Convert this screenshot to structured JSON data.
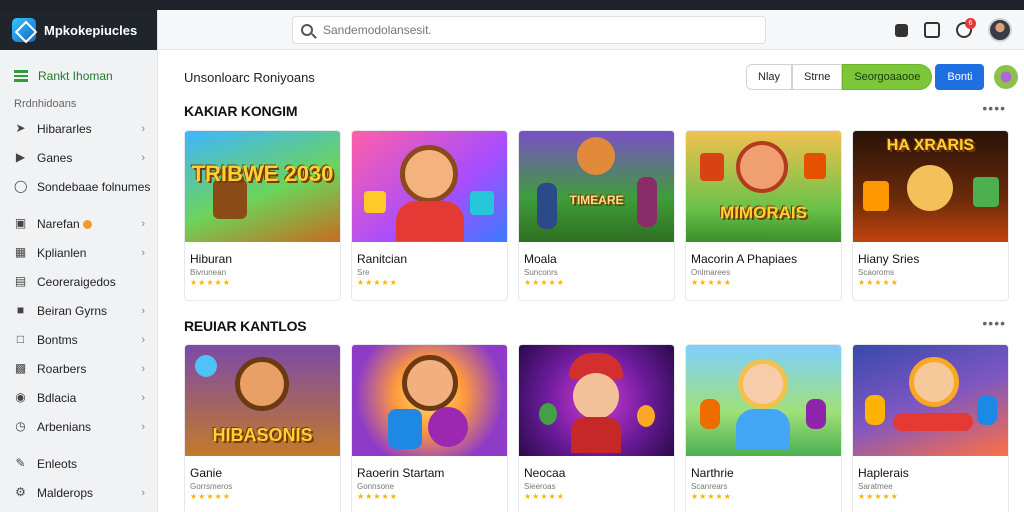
{
  "app": {
    "name": "Mpkokepiucles"
  },
  "search": {
    "placeholder": "Sandemodolansesit."
  },
  "header": {
    "notification_count": "6"
  },
  "sidebar": {
    "active_item": "Rankt Ihoman",
    "section_label": "Rrdnhidoans",
    "items": [
      {
        "label": "Hibararles",
        "icon": "rocket-icon"
      },
      {
        "label": "Ganes",
        "icon": "chat-icon"
      },
      {
        "label": "Sondebaae folnumes",
        "icon": "globe-icon"
      },
      {
        "label": "Narefan",
        "icon": "tv-icon"
      },
      {
        "label": "Kplianlen",
        "icon": "calendar-icon"
      },
      {
        "label": "Ceoreraigedos",
        "icon": "folder-icon"
      },
      {
        "label": "Beiran Gyrns",
        "icon": "user-icon"
      },
      {
        "label": "Bontms",
        "icon": "box-icon"
      },
      {
        "label": "Roarbers",
        "icon": "tag-icon"
      },
      {
        "label": "Bdlacia",
        "icon": "shield-icon"
      },
      {
        "label": "Arbenians",
        "icon": "clock-icon"
      },
      {
        "label": "Enleots",
        "icon": "pencil-icon"
      },
      {
        "label": "Malderops",
        "icon": "settings-icon"
      }
    ]
  },
  "page": {
    "title": "Unsonloarc Roniyoans",
    "tabs": [
      "Nlay",
      "Strne",
      "Seorgoaaooe",
      "Bonti"
    ]
  },
  "sections": [
    {
      "title": "KAKIAR KONGIM",
      "more": "••••",
      "cards": [
        {
          "name": "Hiburan",
          "sub": "Bivrunean",
          "stars": "★★★★★",
          "art": "TRIBWE 2030"
        },
        {
          "name": "Ranitcian",
          "sub": "Sre",
          "stars": "★★★★★",
          "art": ""
        },
        {
          "name": "Moala",
          "sub": "Sunconrs",
          "stars": "★★★★★",
          "art": "TIMEARE"
        },
        {
          "name": "Macorin A Phapiaes",
          "sub": "Onlmarees",
          "stars": "★★★★★",
          "art": "MIMORAIS"
        },
        {
          "name": "Hiany Sries",
          "sub": "Scaoroms",
          "stars": "★★★★★",
          "art": "HA XRARIS"
        }
      ]
    },
    {
      "title": "REUIAR KANTLOS",
      "more": "••••",
      "cards": [
        {
          "name": "Ganie",
          "sub": "Gorrsmeros",
          "stars": "★★★★★",
          "art": "HIBASONIS"
        },
        {
          "name": "Raoerin Startam",
          "sub": "Gonnsone",
          "stars": "★★★★★",
          "art": ""
        },
        {
          "name": "Neocaa",
          "sub": "Sieeroas",
          "stars": "★★★★★",
          "art": ""
        },
        {
          "name": "Narthrie",
          "sub": "Scanrears",
          "stars": "★★★★★",
          "art": ""
        },
        {
          "name": "Haplerais",
          "sub": "Saratmee",
          "stars": "★★★★★",
          "art": ""
        }
      ]
    }
  ],
  "colors": {
    "accent_green": "#7cc63a",
    "accent_blue": "#1e6fe0",
    "sidebar_active": "#2e9d3a",
    "star": "#f5b50a"
  }
}
